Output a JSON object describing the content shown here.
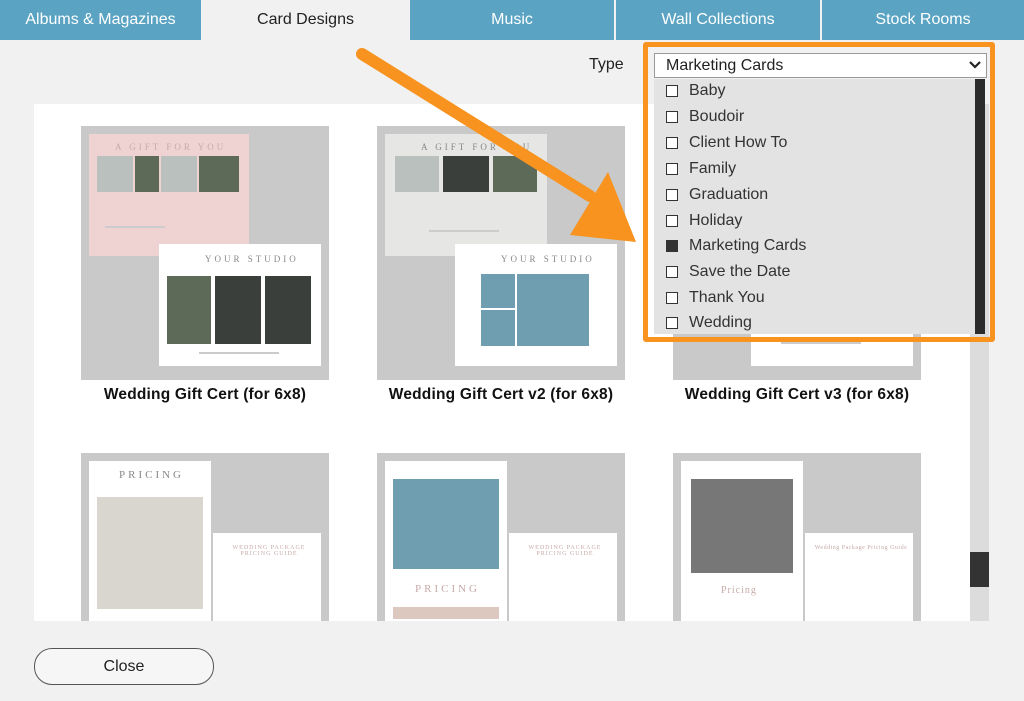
{
  "tabs": [
    {
      "label": "Albums & Magazines"
    },
    {
      "label": "Card Designs"
    },
    {
      "label": "Music"
    },
    {
      "label": "Wall Collections"
    },
    {
      "label": "Stock Rooms"
    }
  ],
  "active_tab": "Card Designs",
  "filter": {
    "label": "Type",
    "selected": "Marketing Cards",
    "options": [
      {
        "label": "Baby",
        "checked": false
      },
      {
        "label": "Boudoir",
        "checked": false
      },
      {
        "label": "Client How To",
        "checked": false
      },
      {
        "label": "Family",
        "checked": false
      },
      {
        "label": "Graduation",
        "checked": false
      },
      {
        "label": "Holiday",
        "checked": false
      },
      {
        "label": "Marketing Cards",
        "checked": true
      },
      {
        "label": "Save the Date",
        "checked": false
      },
      {
        "label": "Thank You",
        "checked": false
      },
      {
        "label": "Wedding",
        "checked": false
      }
    ]
  },
  "cards": [
    {
      "title": "Wedding Gift Cert (for 6x8)",
      "thumb_heading": "A GIFT FOR YOU",
      "thumb_subheading": "YOUR STUDIO"
    },
    {
      "title": "Wedding Gift Cert v2 (for 6x8)",
      "thumb_heading": "A GIFT FOR YOU",
      "thumb_subheading": "YOUR STUDIO"
    },
    {
      "title": "Wedding Gift Cert v3 (for 6x8)",
      "thumb_heading": "",
      "thumb_subheading": ""
    },
    {
      "title": "",
      "thumb_heading": "PRICING",
      "thumb_subheading": "WEDDING PACKAGE PRICING GUIDE"
    },
    {
      "title": "",
      "thumb_heading": "PRICING",
      "thumb_subheading": "WEDDING PACKAGE PRICING GUIDE"
    },
    {
      "title": "",
      "thumb_heading": "Pricing",
      "thumb_subheading": "Wedding Package Pricing Guide"
    }
  ],
  "close_label": "Close",
  "colors": {
    "tab_bg": "#5aa3c2",
    "highlight": "#f7931e",
    "arrow": "#f7931e"
  }
}
